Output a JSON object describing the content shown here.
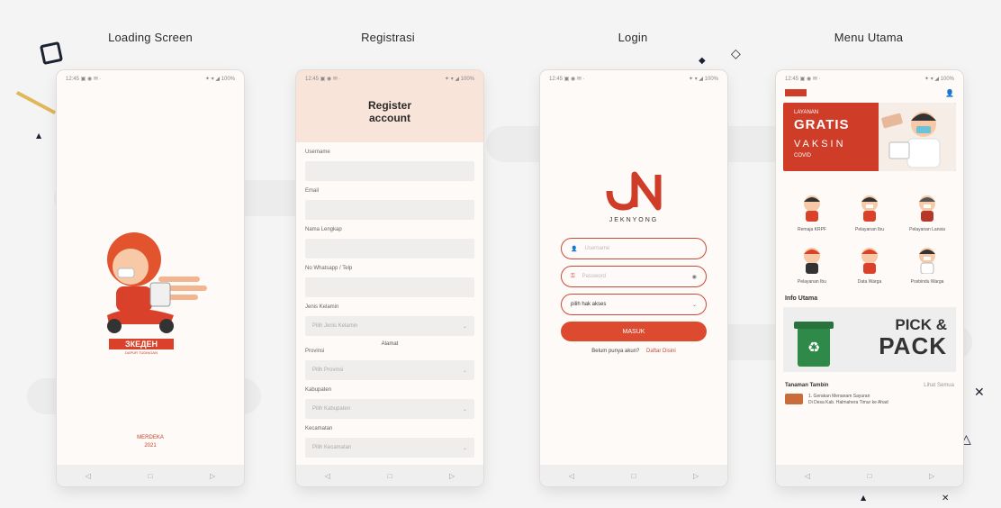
{
  "screens": {
    "loading": {
      "title": "Loading Screen",
      "brand": "ЗКЕДЕН",
      "tagline": "DAPUR TUDINGAN",
      "footer1": "MERDEKA",
      "footer2": "2021"
    },
    "registration": {
      "title": "Registrasi",
      "header": "Register account",
      "fields": [
        "Username",
        "Email",
        "Nama Lengkap",
        "No Whatsapp / Telp"
      ],
      "gender_label": "Jenis Kelamin",
      "gender_placeholder": "Pilih Jenis Kelamin",
      "section": "Alamat",
      "province_label": "Provinsi",
      "province_placeholder": "Pilih Provinsi",
      "city_label": "Kabupaten",
      "city_placeholder": "Pilih Kabupaten",
      "district_label": "Kecamatan",
      "district_placeholder": "Pilih Kecamatan"
    },
    "login": {
      "title": "Login",
      "brand": "JEKNYONG",
      "username_placeholder": "Username",
      "password_placeholder": "Password",
      "role_value": "pilih hak akses",
      "button": "MASUK",
      "link1": "Belum punya akun?",
      "link2": "Daftar Disini"
    },
    "menu": {
      "title": "Menu Utama",
      "banner_line1": "LAYANAN",
      "banner_line2": "GRATIS",
      "banner_line3": "VAKSIN",
      "banner_line4": "COVID",
      "items": [
        "Remaja KRPF",
        "Pelayanan Ibu",
        "Pelayanan Lansia",
        "Pelayanan Ibu",
        "Data Warga",
        "Posbindu Warga"
      ],
      "info_title": "Info Utama",
      "info_word1": "PICK &",
      "info_word2": "PACK",
      "news_title": "Tanaman Tambin",
      "news_more": "Lihat Semua",
      "news_line1": "1. Gerakan Menanam Sayuran",
      "news_line2": "Di Desa Kab. Halmahera Timur ke Ahad"
    }
  },
  "status_bar": {
    "left": "12:45 ▣ ◉ ✉ ·",
    "right": "✦ ▾ ◢ 100%"
  },
  "colors": {
    "brand": "#dc4a30",
    "accent_bg": "#f9e4da",
    "dark_red": "#c94a3a"
  },
  "icons": {
    "nav_back": "◁",
    "nav_home": "□",
    "nav_recent": "▷"
  }
}
